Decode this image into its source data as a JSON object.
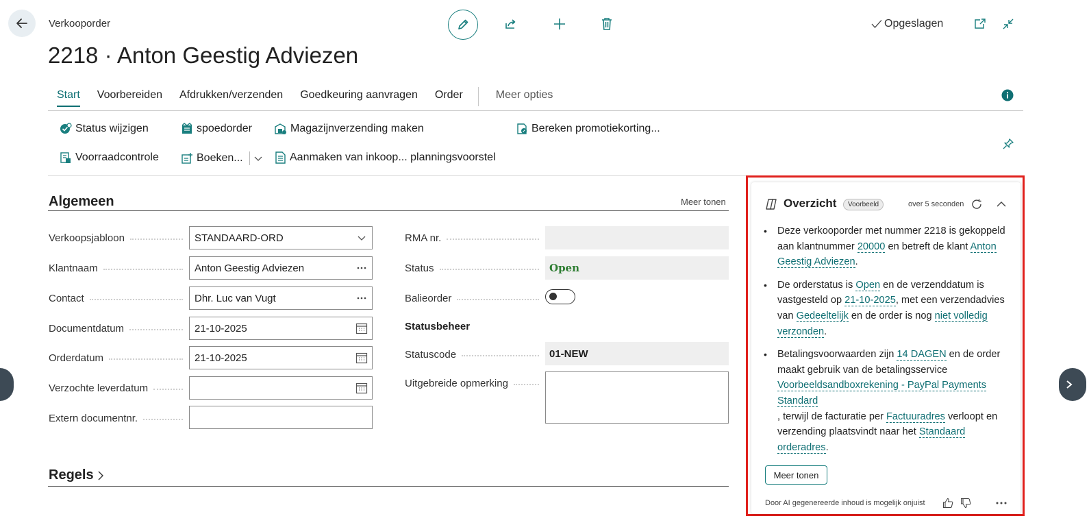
{
  "header": {
    "page_type": "Verkooporder",
    "title": "2218 · Anton Geestig Adviezen",
    "saved_label": "Opgeslagen"
  },
  "icons": {
    "back": "arrow-left-icon",
    "edit": "pencil-icon",
    "share": "share-icon",
    "new": "plus-icon",
    "delete": "trash-icon",
    "open_new": "open-in-new-window-icon",
    "collapse": "collapse-icon",
    "info": "info-icon",
    "pin": "pin-icon",
    "copilot": "copilot-icon"
  },
  "nav": {
    "tabs": [
      "Start",
      "Voorbereiden",
      "Afdrukken/verzenden",
      "Goedkeuring aanvragen",
      "Order"
    ],
    "more": "Meer opties"
  },
  "actions": {
    "status_wijzigen": "Status wijzigen",
    "spoedorder": "spoedorder",
    "magazijnverzending": "Magazijnverzending maken",
    "promotiekorting": "Bereken promotiekorting...",
    "voorraadcontrole": "Voorraadcontrole",
    "boeken": "Boeken...",
    "inkoop_planning": "Aanmaken van inkoop... planningsvoorstel"
  },
  "general": {
    "title": "Algemeen",
    "show_more": "Meer tonen",
    "fields": {
      "verkoopsjabloon": {
        "label": "Verkoopsjabloon",
        "value": "STANDAARD-ORD"
      },
      "klantnaam": {
        "label": "Klantnaam",
        "value": "Anton Geestig Adviezen"
      },
      "contact": {
        "label": "Contact",
        "value": "Dhr. Luc van Vugt"
      },
      "documentdatum": {
        "label": "Documentdatum",
        "value": "21-10-2025"
      },
      "orderdatum": {
        "label": "Orderdatum",
        "value": "21-10-2025"
      },
      "verzochte_leverdatum": {
        "label": "Verzochte leverdatum",
        "value": ""
      },
      "extern_documentnr": {
        "label": "Extern documentnr.",
        "value": ""
      },
      "rma_nr": {
        "label": "RMA nr.",
        "value": ""
      },
      "status": {
        "label": "Status",
        "value": "Open"
      },
      "balieorder": {
        "label": "Balieorder",
        "value": false
      },
      "statusbeheer": "Statusbeheer",
      "statuscode": {
        "label": "Statuscode",
        "value": "01-NEW"
      },
      "uitgebreide_opmerking": {
        "label": "Uitgebreide opmerking",
        "value": ""
      }
    }
  },
  "lines": {
    "title": "Regels"
  },
  "overview": {
    "title": "Overzicht",
    "badge": "Voorbeeld",
    "timestamp": "over 5 seconden",
    "b1_t1": "Deze verkooporder met nummer 2218 is gekoppeld aan klantnummer ",
    "b1_l1": "20000",
    "b1_t2": " en betreft de klant ",
    "b1_l2": "Anton Geestig Adviezen",
    "b1_t3": ".",
    "b2_t1": "De orderstatus is ",
    "b2_l1": "Open",
    "b2_t2": " en de verzenddatum is vastgesteld op ",
    "b2_l2": "21-10-2025",
    "b2_t3": ", met een verzendadvies van ",
    "b2_l3": "Gedeeltelijk",
    "b2_t4": " en de order is nog ",
    "b2_l4": "niet volledig verzonden",
    "b2_t5": ".",
    "b3_t1": "Betalingsvoorwaarden zijn ",
    "b3_l1": "14 DAGEN",
    "b3_t2": " en de order maakt gebruik van de betalingsservice ",
    "b3_l2": "Voorbeeldsandboxrekening - PayPal Payments Standard",
    "b3_t3": ", terwijl de facturatie per ",
    "b3_l3": "Factuuradres",
    "b3_t4": " verloopt en verzending plaatsvindt naar het ",
    "b3_l4": "Standaard orderadres",
    "b3_t5": ".",
    "show_more": "Meer tonen",
    "disclaimer": "Door AI gegenereerde inhoud is mogelijk onjuist"
  },
  "colors": {
    "accent": "#0f6f73",
    "highlight": "#e0201c",
    "status_open": "#2e7d32"
  }
}
